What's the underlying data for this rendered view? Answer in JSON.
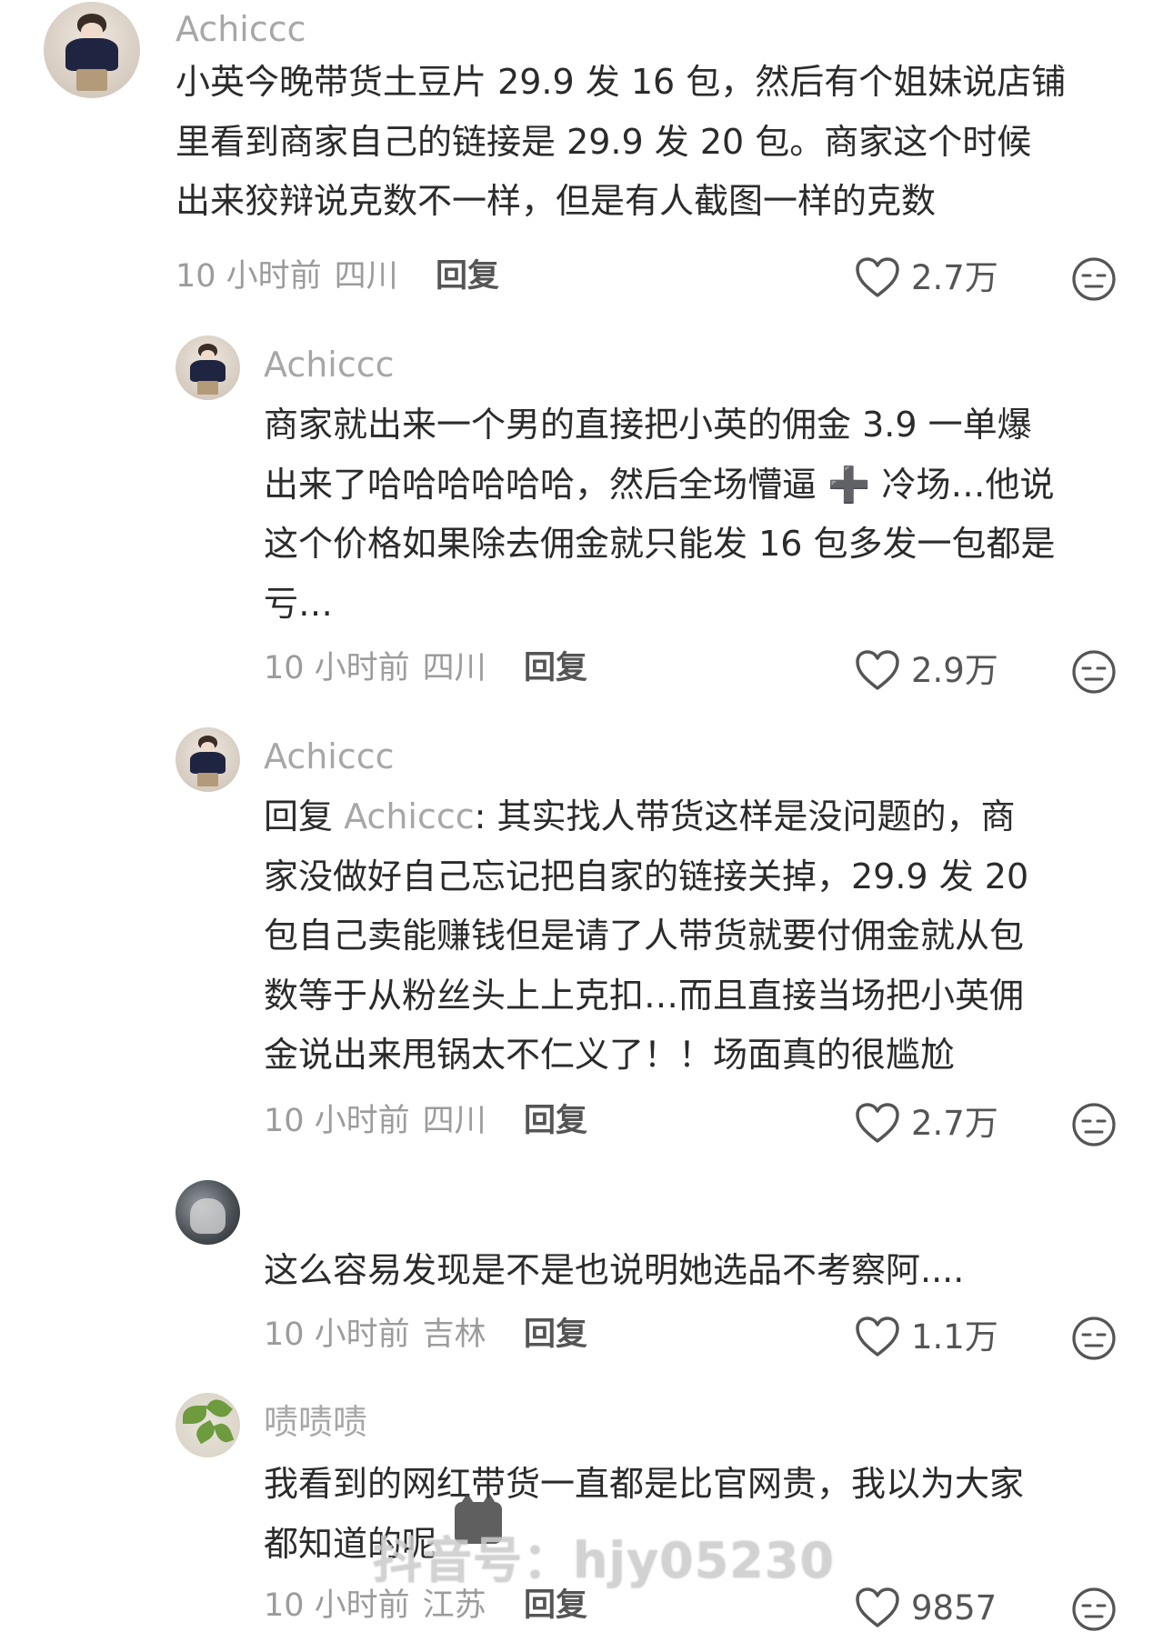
{
  "comments": [
    {
      "username": "Achiccc",
      "text": "小英今晚带货土豆片 29.9 发 16 包，然后有个姐妹说店铺\n里看到商家自己的链接是 29.9 发 20 包。商家这个时候\n出来狡辩说克数不一样，但是有人截图一样的克数",
      "time": "10 小时前",
      "region": "四川",
      "reply_label": "回复",
      "likes": "2.7万"
    },
    {
      "username": "Achiccc",
      "text": "商家就出来一个男的直接把小英的佣金 3.9 一单爆\n出来了哈哈哈哈哈哈，然后全场懵逼 ➕ 冷场…他说\n这个价格如果除去佣金就只能发 16 包多发一包都是\n亏…",
      "time": "10 小时前",
      "region": "四川",
      "reply_label": "回复",
      "likes": "2.9万"
    },
    {
      "username": "Achiccc",
      "reply_prefix": "回复 ",
      "mention": "Achiccc",
      "text": ": 其实找人带货这样是没问题的，商\n家没做好自己忘记把自家的链接关掉，29.9 发 20\n包自己卖能赚钱但是请了人带货就要付佣金就从包\n数等于从粉丝头上上克扣…而且直接当场把小英佣\n金说出来甩锅太不仁义了！！场面真的很尴尬",
      "time": "10 小时前",
      "region": "四川",
      "reply_label": "回复",
      "likes": "2.7万"
    },
    {
      "username": "",
      "text": "这么容易发现是不是也说明她选品不考察阿....",
      "time": "10 小时前",
      "region": "吉林",
      "reply_label": "回复",
      "likes": "1.1万"
    },
    {
      "username": "啧啧啧",
      "text": "我看到的网红带货一直都是比官网贵，我以为大家\n都知道的呢",
      "time": "10 小时前",
      "region": "江苏",
      "reply_label": "回复",
      "likes": "9857"
    }
  ],
  "watermark": "抖音号：hjy05230",
  "icons": {
    "like": "heart-outline-icon",
    "dislike": "meh-face-icon"
  },
  "colors": {
    "text": "#2b2b2b",
    "muted": "#a7a7a7",
    "icon": "#555555"
  }
}
